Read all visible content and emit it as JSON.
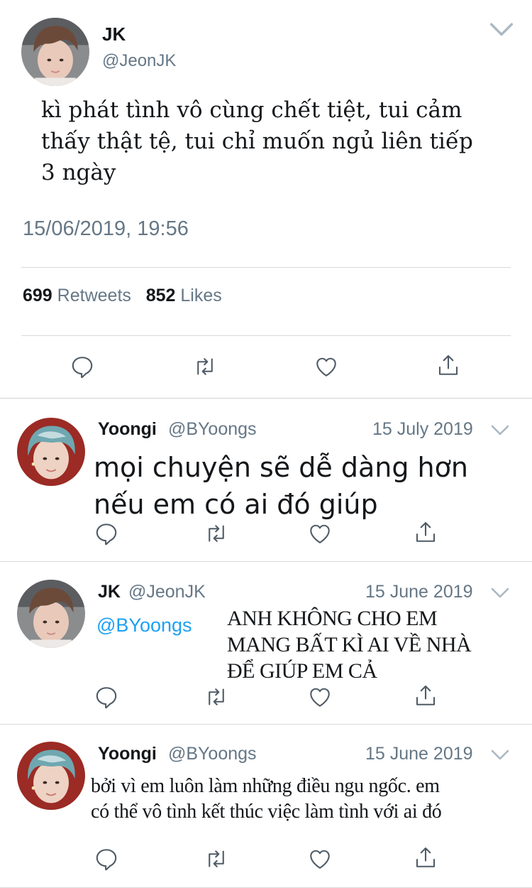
{
  "main_tweet": {
    "name": "JK",
    "handle": "@JeonJK",
    "text_lines": [
      "kì phát tình vô cùng chết tiệt, tui cảm",
      "thấy thật tệ, tui chỉ muốn ngủ liên tiếp",
      "3 ngày"
    ],
    "timestamp": "15/06/2019, 19:56",
    "retweets_count": "699",
    "retweets_label": "Retweets",
    "likes_count": "852",
    "likes_label": "Likes"
  },
  "replies": [
    {
      "name": "Yoongi",
      "handle": "@BYoongs",
      "date": "15 July 2019",
      "text_lines": [
        "mọi chuyện sẽ dễ dàng hơn",
        "nếu em có ai đó giúp"
      ]
    },
    {
      "name": "JK",
      "handle": "@JeonJK",
      "date": "15 June 2019",
      "mention": "@BYoongs",
      "text_lines": [
        "ANH KHÔNG CHO EM",
        "MANG BẤT KÌ AI VỀ NHÀ",
        "ĐỂ GIÚP EM CẢ"
      ]
    },
    {
      "name": "Yoongi",
      "handle": "@BYoongs",
      "date": "15 June 2019",
      "text_lines": [
        "bởi vì em luôn làm những điều ngu ngốc. em",
        "có thể vô tình kết thúc việc làm tình với ai đó"
      ]
    }
  ],
  "icons": {
    "reply": "reply-icon",
    "retweet": "retweet-icon",
    "like": "heart-icon",
    "share": "share-icon",
    "chevron": "chevron-down-icon"
  },
  "colors": {
    "text": "#14171a",
    "secondary": "#657786",
    "link": "#1da1f2",
    "divider": "#d6d9dc"
  }
}
